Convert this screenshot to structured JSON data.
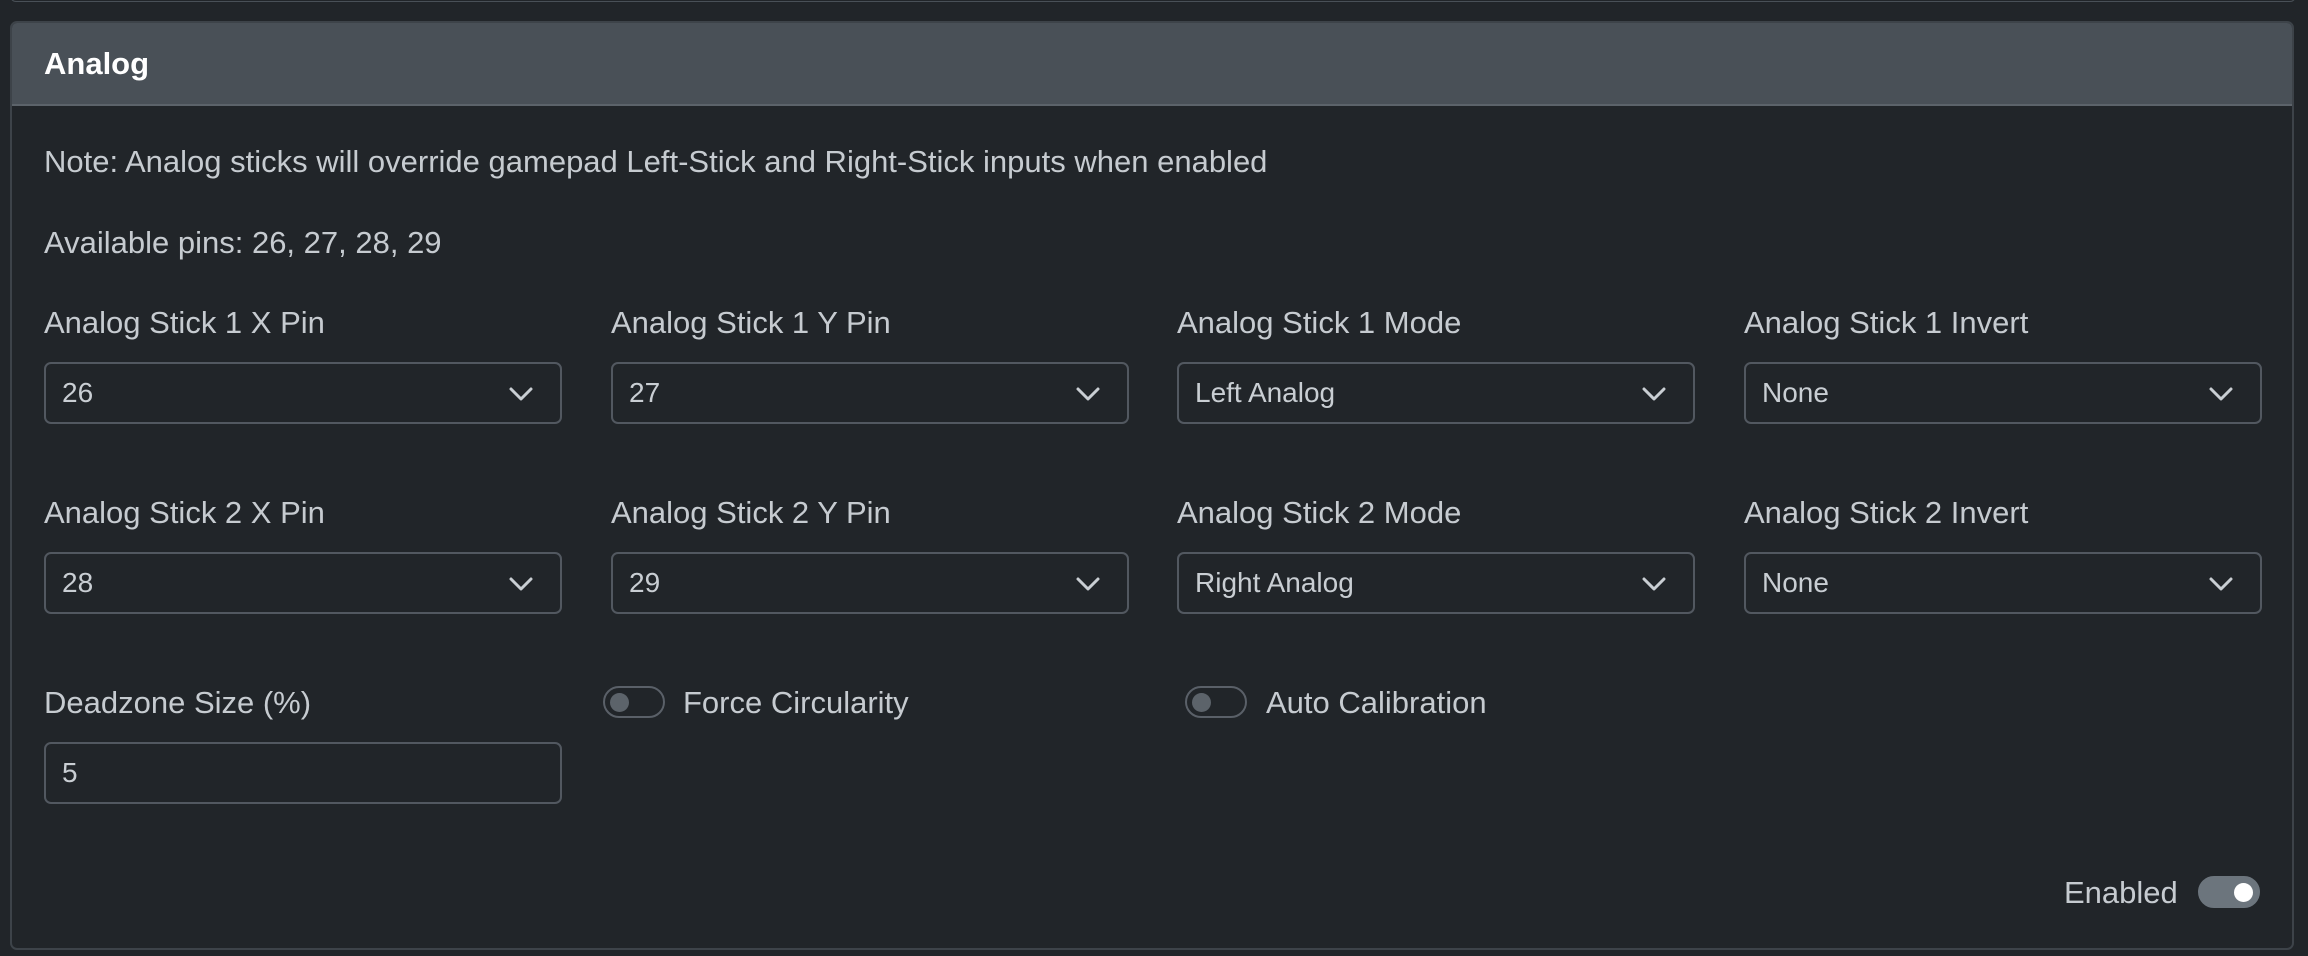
{
  "card": {
    "title": "Analog",
    "note": "Note: Analog sticks will override gamepad Left-Stick and Right-Stick inputs when enabled",
    "available_pins": "Available pins: 26, 27, 28, 29"
  },
  "fields": {
    "stick1_x": {
      "label": "Analog Stick 1 X Pin",
      "value": "26"
    },
    "stick1_y": {
      "label": "Analog Stick 1 Y Pin",
      "value": "27"
    },
    "stick1_mode": {
      "label": "Analog Stick 1 Mode",
      "value": "Left Analog"
    },
    "stick1_invert": {
      "label": "Analog Stick 1 Invert",
      "value": "None"
    },
    "stick2_x": {
      "label": "Analog Stick 2 X Pin",
      "value": "28"
    },
    "stick2_y": {
      "label": "Analog Stick 2 Y Pin",
      "value": "29"
    },
    "stick2_mode": {
      "label": "Analog Stick 2 Mode",
      "value": "Right Analog"
    },
    "stick2_invert": {
      "label": "Analog Stick 2 Invert",
      "value": "None"
    },
    "deadzone": {
      "label": "Deadzone Size (%)",
      "value": "5"
    }
  },
  "toggles": {
    "force_circularity": {
      "label": "Force Circularity",
      "state": "off"
    },
    "auto_calibration": {
      "label": "Auto Calibration",
      "state": "off"
    },
    "enabled": {
      "label": "Enabled",
      "state": "on"
    }
  },
  "icons": {
    "dropdown": "chevron-down-icon"
  },
  "colors": {
    "background": "#212529",
    "header": "#495057",
    "border": "#525860",
    "text": "#c6cbd0"
  }
}
